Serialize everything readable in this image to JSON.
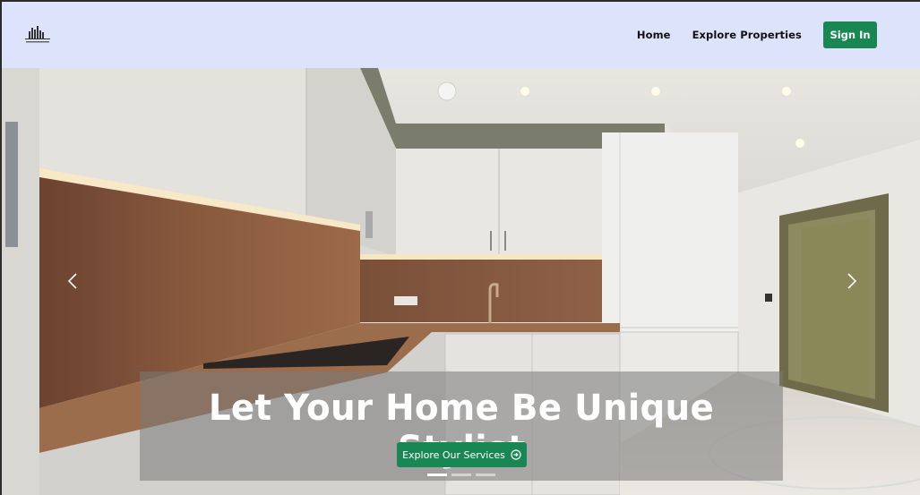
{
  "nav": {
    "logo_icon": "building-skyline-icon",
    "links": [
      "Home",
      "Explore Properties"
    ],
    "signin_label": "Sign In"
  },
  "hero": {
    "headline": "Let Your Home Be Unique Stylist",
    "cta_label": "Explore Our Services",
    "cta_icon": "arrow-right-circle-icon",
    "prev_icon": "chevron-left-icon",
    "next_icon": "chevron-right-icon",
    "slides_count": 3,
    "active_slide": 1
  },
  "colors": {
    "navbar_bg": "#dee3fc",
    "accent": "#198754"
  }
}
